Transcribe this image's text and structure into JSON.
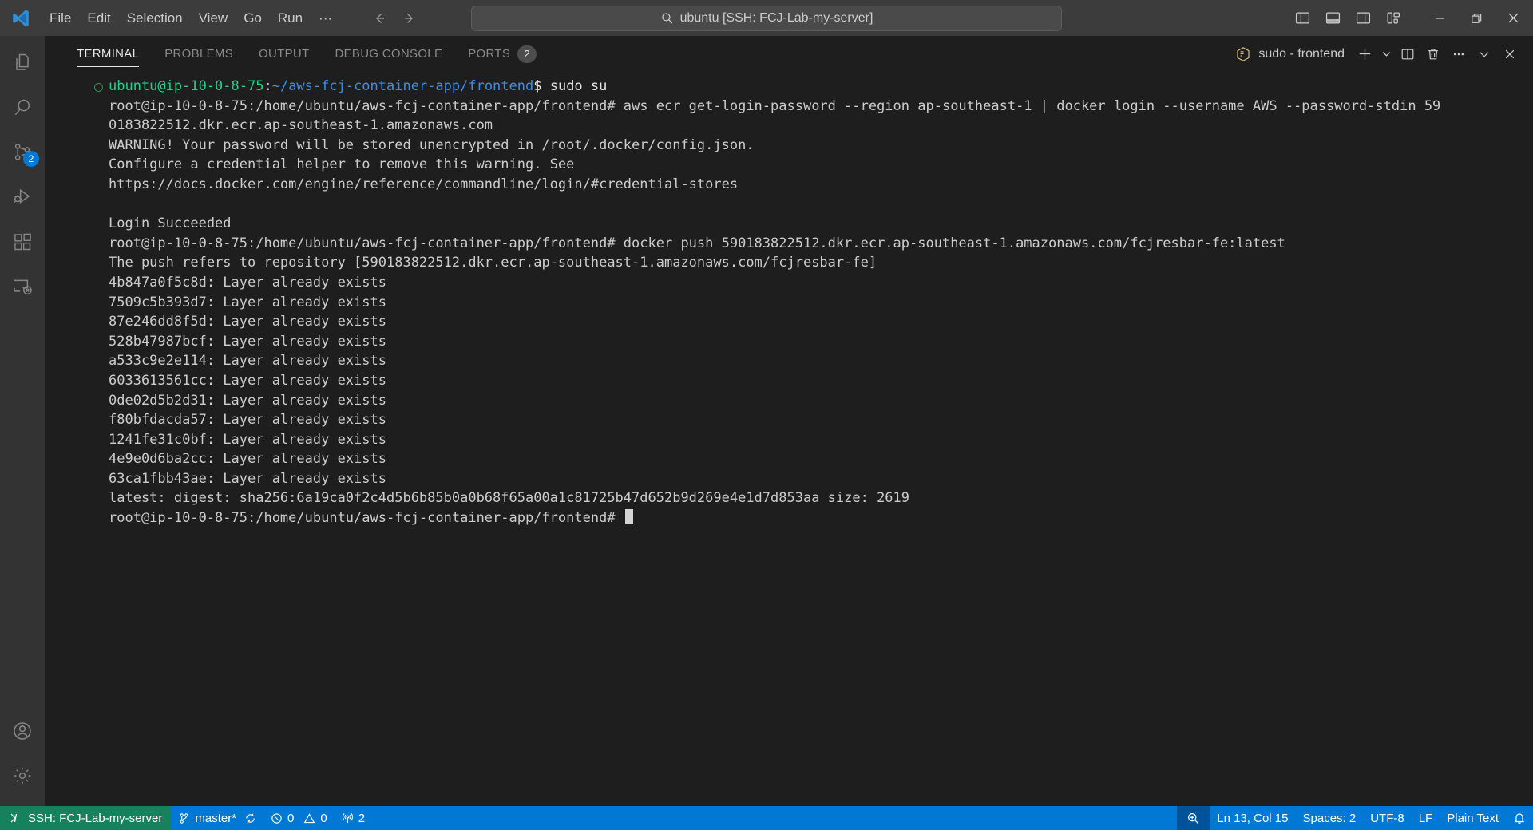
{
  "titlebar": {
    "logo_icon": "vscode-logo-icon",
    "menu": [
      {
        "label": "File",
        "name": "menu-file"
      },
      {
        "label": "Edit",
        "name": "menu-edit"
      },
      {
        "label": "Selection",
        "name": "menu-selection"
      },
      {
        "label": "View",
        "name": "menu-view"
      },
      {
        "label": "Go",
        "name": "menu-go"
      },
      {
        "label": "Run",
        "name": "menu-run"
      },
      {
        "label": "···",
        "name": "menu-more"
      }
    ],
    "nav": {
      "back_icon": "arrow-left-icon",
      "forward_icon": "arrow-right-icon"
    },
    "command_center": {
      "text": "ubuntu [SSH: FCJ-Lab-my-server]",
      "search_icon": "search-icon"
    },
    "layout_icons": [
      "toggle-primary-sidebar-icon",
      "toggle-panel-icon",
      "toggle-secondary-sidebar-icon",
      "customize-layout-icon"
    ],
    "window_controls": {
      "minimize": "minimize-icon",
      "restore": "restore-icon",
      "close": "close-icon"
    }
  },
  "activitybar": {
    "items": [
      {
        "name": "sidebar-item-explorer",
        "icon": "files-icon",
        "badge": null
      },
      {
        "name": "sidebar-item-search",
        "icon": "search-icon",
        "badge": null
      },
      {
        "name": "sidebar-item-source-control",
        "icon": "source-control-icon",
        "badge": "2"
      },
      {
        "name": "sidebar-item-run-debug",
        "icon": "run-and-debug-icon",
        "badge": null
      },
      {
        "name": "sidebar-item-extensions",
        "icon": "extensions-icon",
        "badge": null
      },
      {
        "name": "sidebar-item-remote-explorer",
        "icon": "remote-explorer-icon",
        "badge": null
      }
    ],
    "bottom_items": [
      {
        "name": "account-button",
        "icon": "account-icon"
      },
      {
        "name": "settings-button",
        "icon": "gear-icon"
      }
    ]
  },
  "panel": {
    "tabs": [
      {
        "label": "TERMINAL",
        "name": "tab-terminal",
        "active": true,
        "badge": null
      },
      {
        "label": "PROBLEMS",
        "name": "tab-problems",
        "active": false,
        "badge": null
      },
      {
        "label": "OUTPUT",
        "name": "tab-output",
        "active": false,
        "badge": null
      },
      {
        "label": "DEBUG CONSOLE",
        "name": "tab-debug-console",
        "active": false,
        "badge": null
      },
      {
        "label": "PORTS",
        "name": "tab-ports",
        "active": false,
        "badge": "2"
      }
    ],
    "terminal_instance_label": "sudo - frontend",
    "terminal_instance_icon": "terminal-cube-icon",
    "actions": [
      {
        "name": "new-terminal-button",
        "icon": "plus-icon"
      },
      {
        "name": "terminal-profile-dropdown",
        "icon": "chevron-down-icon"
      },
      {
        "name": "split-terminal-button",
        "icon": "split-editor-icon"
      },
      {
        "name": "kill-terminal-button",
        "icon": "trash-icon"
      },
      {
        "name": "panel-more-actions-button",
        "icon": "ellipsis-icon"
      },
      {
        "name": "hide-panel-button",
        "icon": "chevron-down-icon"
      },
      {
        "name": "close-panel-button",
        "icon": "close-icon"
      }
    ]
  },
  "terminal": {
    "prompt1": {
      "user_host": "ubuntu@ip-10-0-8-75",
      "separator": ":",
      "path": "~/aws-fcj-container-app/frontend",
      "sigil": "$ ",
      "command": "sudo su"
    },
    "lines": [
      "root@ip-10-0-8-75:/home/ubuntu/aws-fcj-container-app/frontend# aws ecr get-login-password --region ap-southeast-1 | docker login --username AWS --password-stdin 59",
      "0183822512.dkr.ecr.ap-southeast-1.amazonaws.com",
      "WARNING! Your password will be stored unencrypted in /root/.docker/config.json.",
      "Configure a credential helper to remove this warning. See",
      "https://docs.docker.com/engine/reference/commandline/login/#credential-stores",
      "",
      "Login Succeeded",
      "root@ip-10-0-8-75:/home/ubuntu/aws-fcj-container-app/frontend# docker push 590183822512.dkr.ecr.ap-southeast-1.amazonaws.com/fcjresbar-fe:latest",
      "The push refers to repository [590183822512.dkr.ecr.ap-southeast-1.amazonaws.com/fcjresbar-fe]",
      "4b847a0f5c8d: Layer already exists",
      "7509c5b393d7: Layer already exists",
      "87e246dd8f5d: Layer already exists",
      "528b47987bcf: Layer already exists",
      "a533c9e2e114: Layer already exists",
      "6033613561cc: Layer already exists",
      "0de02d5b2d31: Layer already exists",
      "f80bfdacda57: Layer already exists",
      "1241fe31c0bf: Layer already exists",
      "4e9e0d6ba2cc: Layer already exists",
      "63ca1fbb43ae: Layer already exists",
      "latest: digest: sha256:6a19ca0f2c4d5b6b85b0a0b68f65a00a1c81725b47d652b9d269e4e1d7d853aa size: 2619"
    ],
    "final_prompt": "root@ip-10-0-8-75:/home/ubuntu/aws-fcj-container-app/frontend# "
  },
  "statusbar": {
    "remote": {
      "label": "SSH: FCJ-Lab-my-server",
      "icon": "remote-host-icon"
    },
    "branch": {
      "label": "master*",
      "icon": "source-control-icon",
      "sync_icon": "sync-icon"
    },
    "problems": {
      "errors": "0",
      "warnings": "0",
      "error_icon": "error-icon",
      "warning_icon": "warning-icon"
    },
    "ports": {
      "label": "2",
      "icon": "radio-tower-icon"
    },
    "zoom_icon": "screencast-zoom-icon",
    "right_items": [
      {
        "label": "Ln 13, Col 15",
        "name": "editor-position"
      },
      {
        "label": "Spaces: 2",
        "name": "indentation"
      },
      {
        "label": "UTF-8",
        "name": "encoding"
      },
      {
        "label": "LF",
        "name": "eol"
      },
      {
        "label": "Plain Text",
        "name": "language-mode"
      }
    ],
    "bell_icon": "bell-icon"
  },
  "colors": {
    "titlebar_bg": "#3c3c3c",
    "activitybar_bg": "#333333",
    "terminal_bg": "#1e1e1e",
    "statusbar_blue": "#0078d4",
    "statusbar_green": "#16825d",
    "prompt_green": "#23d18b",
    "prompt_blue": "#3b8eea",
    "badge_blue": "#0078d4"
  }
}
